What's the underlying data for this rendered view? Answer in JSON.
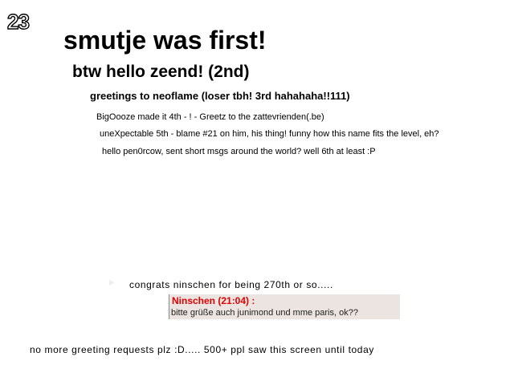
{
  "level": {
    "number": "23"
  },
  "greetings": {
    "line1": "smutje was first!",
    "line2": "btw hello zeend! (2nd)",
    "line3": "greetings to neoflame (loser tbh! 3rd hahahaha!!111)",
    "line4": "BigOooze made it 4th - ! - Greetz to the zattevrienden(.be)",
    "line5": "uneXpectable 5th - blame #21 on him, his thing! funny how this name fits the level, eh?",
    "line6": "hello pen0rcow, sent short msgs around the world? well 6th at least :P"
  },
  "congrats": "congrats ninschen for being 270th or so.....",
  "chat": {
    "name": "Ninschen (21:04) :",
    "message": "bitte grüße auch junimond und mme paris, ok??"
  },
  "footer": "no more greeting requests plz :D..... 500+ ppl saw this screen until today",
  "colors": {
    "chat_name": "#e00000",
    "chat_background": "#ece4e0",
    "background": "#ffffff"
  }
}
